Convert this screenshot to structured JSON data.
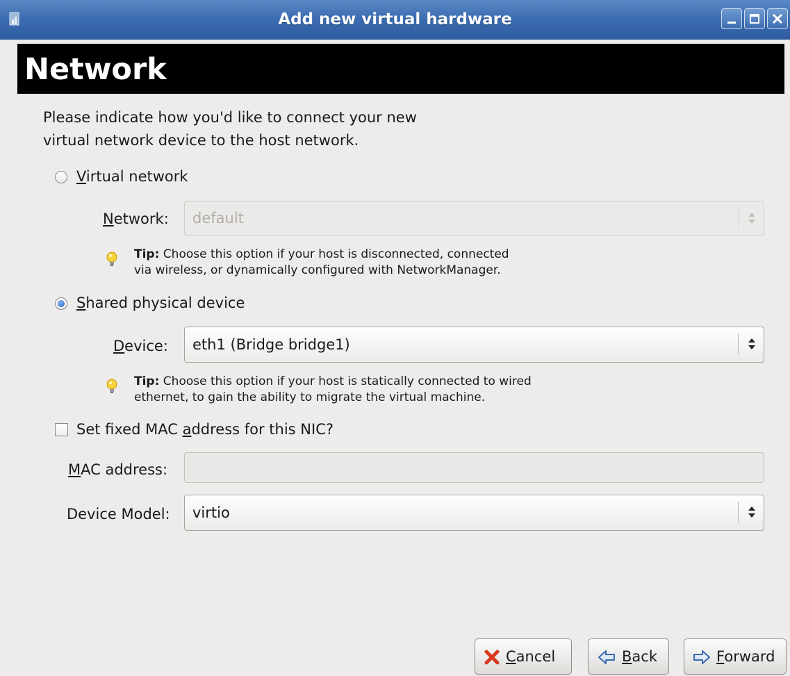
{
  "window": {
    "title": "Add new virtual hardware",
    "controls": [
      "minimize-icon",
      "maximize-icon",
      "close-icon"
    ]
  },
  "page": {
    "heading": "Network",
    "intro_line1": "Please indicate how you'd like to connect your new",
    "intro_line2": "virtual network device to the host network."
  },
  "virtual_network": {
    "mnemonic": "V",
    "label_rest": "irtual network",
    "selected": false,
    "network_mnemonic": "N",
    "network_label_rest": "etwork:",
    "network_value": "default",
    "enabled": false,
    "tip_prefix": "Tip:",
    "tip_line1": " Choose this option if your host is disconnected, connected",
    "tip_line2": "via wireless, or dynamically configured with NetworkManager."
  },
  "shared_device": {
    "mnemonic": "S",
    "label_rest": "hared physical device",
    "selected": true,
    "device_mnemonic": "D",
    "device_label_rest": "evice:",
    "device_value": "eth1 (Bridge bridge1)",
    "tip_prefix": "Tip:",
    "tip_line1": " Choose this option if your host is statically connected to wired",
    "tip_line2": "ethernet, to gain the ability to migrate the virtual machine."
  },
  "mac": {
    "checkbox_label_before": "Set fixed MAC ",
    "checkbox_mnemonic": "a",
    "checkbox_label_after": "ddress for this NIC?",
    "checked": false,
    "field_mnemonic": "M",
    "field_label_rest": "AC address:",
    "field_value": ""
  },
  "model": {
    "label": "Device Model:",
    "value": "virtio"
  },
  "buttons": {
    "cancel_mnemonic": "C",
    "cancel_rest": "ancel",
    "back_mnemonic": "B",
    "back_rest": "ack",
    "forward_mnemonic": "F",
    "forward_rest": "orward"
  },
  "colors": {
    "titlebar": "#3a6bb0",
    "header_band": "#000000",
    "background": "#edeceb",
    "radio_selected": "#2a66c0",
    "tip_bulb": "#f2c21b",
    "cancel_icon": "#d9371e",
    "arrow_icon": "#3a6bb0"
  }
}
